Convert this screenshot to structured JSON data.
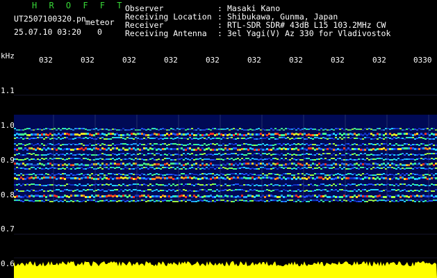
{
  "header": {
    "brand": "H R O F F T",
    "filename": "UT2507100320.pn",
    "meteor_label": "meteor",
    "datetime": "25.07.10 03:20",
    "count": "0"
  },
  "info": {
    "labels": [
      "Observer",
      "Receiving Location",
      "Receiver",
      "Receiving Antenna"
    ],
    "colons": [
      ":",
      ":",
      ":",
      ":"
    ],
    "values": [
      "Masaki Kano",
      "Shibukawa, Gunma, Japan",
      "RTL-SDR SDR# 43dB L15 103.2MHz CW",
      "3el Yagi(V) Az 330 for Vladivostok"
    ]
  },
  "axis": {
    "y_unit": "kHz",
    "y_ticks": [
      "1.1",
      "1.0",
      "0.9",
      "0.8",
      "0.7",
      "0.6"
    ],
    "x_ticks": [
      "032",
      "032",
      "032",
      "032",
      "032",
      "032",
      "032",
      "032",
      "032",
      "0330"
    ]
  },
  "colors": {
    "background": "#000000",
    "brand": "#37d837",
    "spectrum_base": "#0010a0",
    "signal_hot": "#ff3020",
    "power_trace": "#ffff00"
  }
}
